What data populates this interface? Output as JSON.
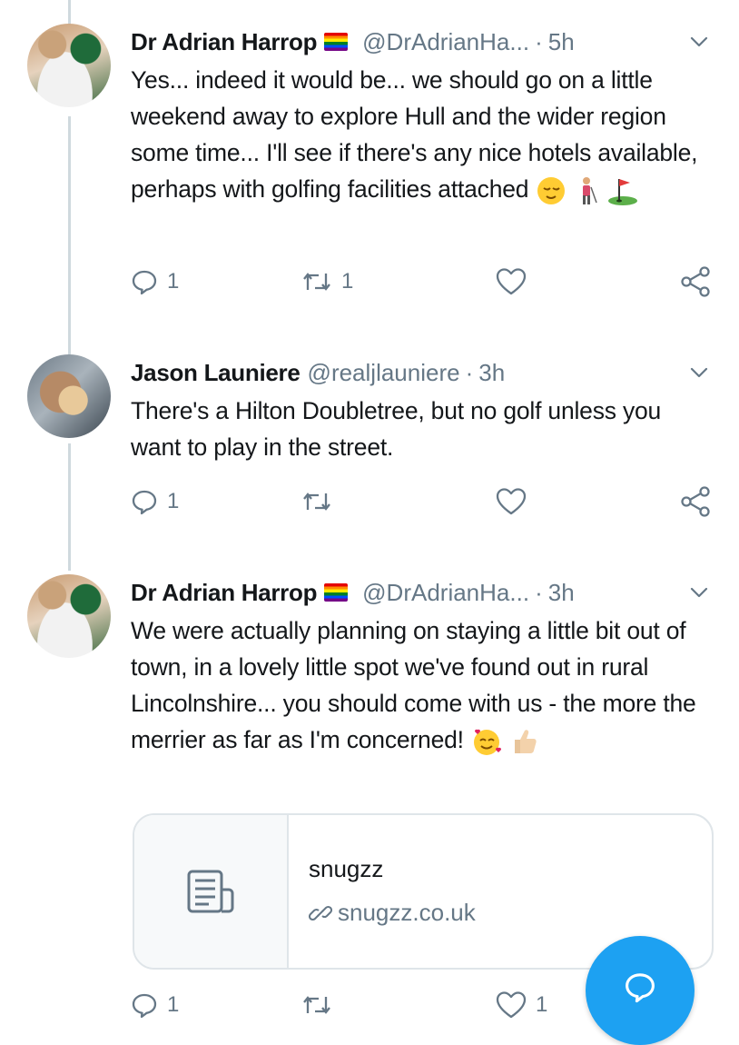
{
  "tweets": [
    {
      "name": "Dr Adrian Harrop",
      "handle": "@DrAdrianHa...",
      "time": "5h",
      "text": "Yes... indeed it would be... we should go on a little weekend away to explore Hull and the wider region some time... I'll see if there's any nice hotels available, perhaps with golfing facilities attached",
      "emojis": [
        "relieved-face",
        "person-golfing",
        "flag-in-hole"
      ],
      "replies": "1",
      "retweets": "1",
      "likes": ""
    },
    {
      "name": "Jason Launiere",
      "handle": "@realjlauniere",
      "time": "3h",
      "text": "There's a Hilton Doubletree, but no golf unless you want to play in the street.",
      "replies": "1",
      "retweets": "",
      "likes": ""
    },
    {
      "name": "Dr Adrian Harrop",
      "handle": "@DrAdrianHa...",
      "time": "3h",
      "text": "We were actually planning on staying a little bit out of town, in a lovely little spot we've found out in rural Lincolnshire... you should come with us - the more the merrier as far as I'm concerned!",
      "emojis": [
        "smiling-face-with-hearts",
        "thumbs-up"
      ],
      "card": {
        "title": "snugzz",
        "url": "snugzz.co.uk"
      },
      "replies": "1",
      "retweets": "",
      "likes": "1"
    }
  ],
  "colors": {
    "accent": "#1da1f2",
    "muted": "#657786",
    "text": "#14171a",
    "border": "#dfe5e9"
  },
  "icons": [
    "reply-icon",
    "retweet-icon",
    "like-icon",
    "share-icon",
    "chevron-down-icon",
    "article-icon",
    "link-icon",
    "compose-icon"
  ]
}
